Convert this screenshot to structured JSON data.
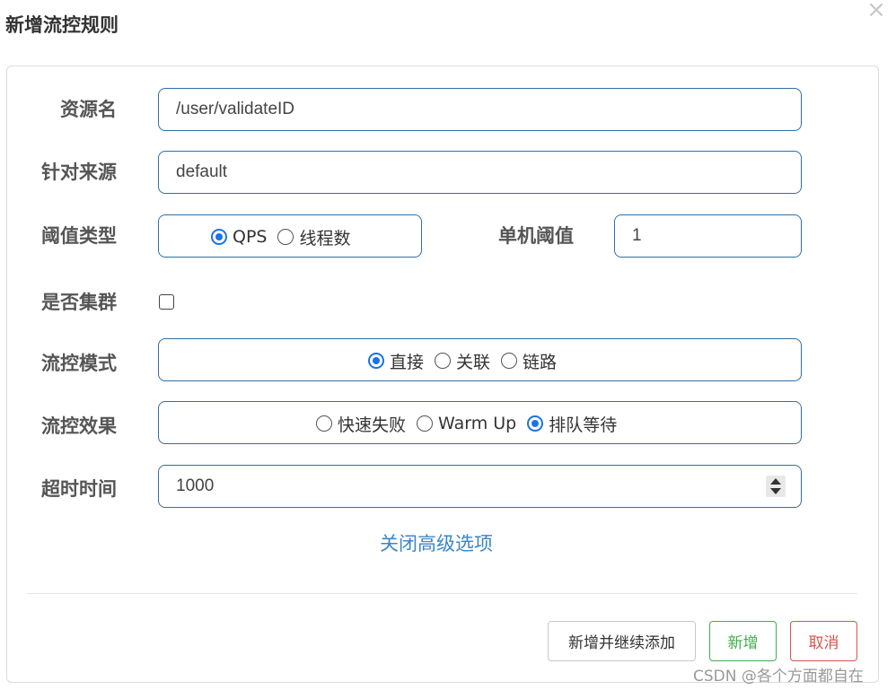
{
  "dialog": {
    "title": "新增流控规则",
    "close_glyph": "×"
  },
  "form": {
    "resource_name": {
      "label": "资源名",
      "value": "/user/validateID"
    },
    "limit_app": {
      "label": "针对来源",
      "value": "default"
    },
    "threshold_type": {
      "label": "阈值类型",
      "options": [
        {
          "label": "QPS",
          "checked": true
        },
        {
          "label": "线程数",
          "checked": false
        }
      ]
    },
    "single_threshold": {
      "label": "单机阈值",
      "value": "1"
    },
    "cluster": {
      "label": "是否集群",
      "checked": false
    },
    "flow_mode": {
      "label": "流控模式",
      "options": [
        {
          "label": "直接",
          "checked": true
        },
        {
          "label": "关联",
          "checked": false
        },
        {
          "label": "链路",
          "checked": false
        }
      ]
    },
    "flow_effect": {
      "label": "流控效果",
      "options": [
        {
          "label": "快速失败",
          "checked": false
        },
        {
          "label": "Warm Up",
          "checked": false
        },
        {
          "label": "排队等待",
          "checked": true
        }
      ]
    },
    "timeout": {
      "label": "超时时间",
      "value": "1000"
    },
    "advanced_toggle": "关闭高级选项"
  },
  "footer": {
    "continue_label": "新增并继续添加",
    "add_label": "新增",
    "cancel_label": "取消"
  },
  "watermark": "CSDN @各个方面都自在",
  "colors": {
    "input_border": "#2f6fa7",
    "radio_checked": "#1a73e8",
    "link": "#3a86c8",
    "add_green": "#3fae4a",
    "cancel_red": "#d9534f"
  }
}
